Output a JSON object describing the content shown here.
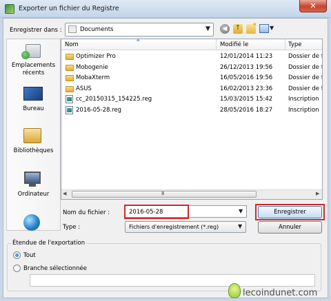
{
  "window": {
    "title": "Exporter un fichier du Registre",
    "close_glyph": "✕"
  },
  "toolbar": {
    "save_in_label": "Enregistrer dans :",
    "save_in_value": "Documents",
    "back_icon": "back-icon",
    "up_icon": "up-folder-icon",
    "new_folder_icon": "new-folder-icon",
    "views_icon": "views-icon"
  },
  "places": [
    {
      "label": "Emplacements récents",
      "icon": "recent-places-icon"
    },
    {
      "label": "Bureau",
      "icon": "desktop-icon"
    },
    {
      "label": "Bibliothèques",
      "icon": "libraries-icon"
    },
    {
      "label": "Ordinateur",
      "icon": "computer-icon"
    },
    {
      "label": "",
      "icon": "network-icon"
    }
  ],
  "file_list": {
    "columns": [
      "Nom",
      "Modifié le",
      "Type"
    ],
    "rows": [
      {
        "name": "Optimizer Pro",
        "modified": "12/01/2014 11:23",
        "type": "Dossier de f",
        "kind": "folder"
      },
      {
        "name": "Mobogenie",
        "modified": "26/12/2013 19:56",
        "type": "Dossier de f",
        "kind": "folder"
      },
      {
        "name": "MobaXterm",
        "modified": "16/05/2016 19:56",
        "type": "Dossier de f",
        "kind": "folder"
      },
      {
        "name": "ASUS",
        "modified": "16/02/2013 23:36",
        "type": "Dossier de f",
        "kind": "folder"
      },
      {
        "name": "cc_20150315_154225.reg",
        "modified": "15/03/2015 15:42",
        "type": "Inscription",
        "kind": "reg"
      },
      {
        "name": "2016-05-28.reg",
        "modified": "28/05/2016 18:27",
        "type": "Inscription",
        "kind": "reg"
      }
    ],
    "scroll_grip": "III"
  },
  "filename": {
    "label": "Nom du fichier :",
    "value": "2016-05-28"
  },
  "filetype": {
    "label": "Type :",
    "value": "Fichiers d'enregistrement (*.reg)"
  },
  "buttons": {
    "save": "Enregistrer",
    "cancel": "Annuler"
  },
  "export_range": {
    "legend": "Étendue de l'exportation",
    "options": [
      {
        "label": "Tout",
        "selected": true
      },
      {
        "label": "Branche sélectionnée",
        "selected": false
      }
    ],
    "branch_value": ""
  },
  "watermark": {
    "text": "lecoindunet.com"
  },
  "colors": {
    "highlight": "#d0282a",
    "accent": "#3c7fb1"
  }
}
